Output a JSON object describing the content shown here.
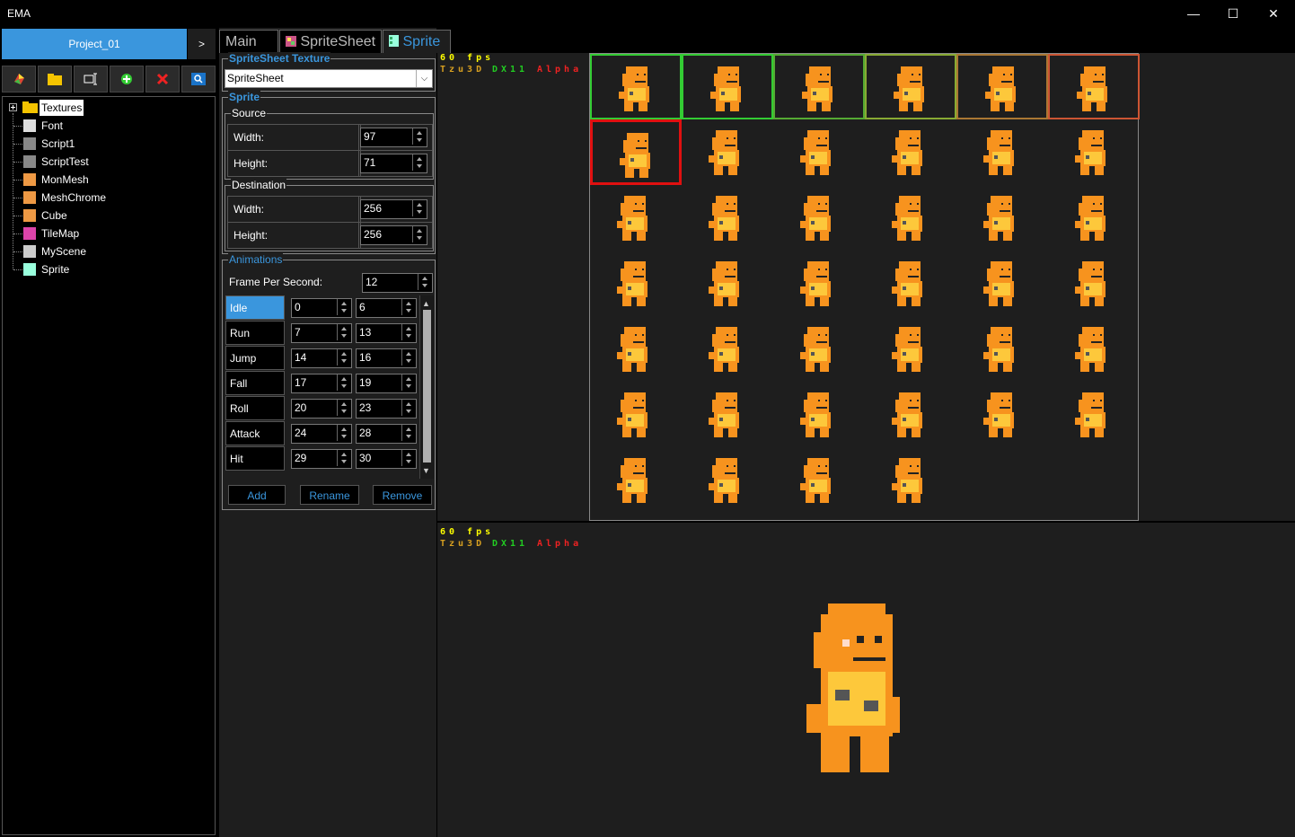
{
  "window": {
    "title": "EMA",
    "minimize": "—",
    "maximize": "☐",
    "close": "✕"
  },
  "project": {
    "name": "Project_01",
    "arrow": ">"
  },
  "toolbar": [
    "new-mesh-icon",
    "folder-icon",
    "rename-icon",
    "add-icon",
    "delete-icon",
    "search-icon"
  ],
  "tree": {
    "root": "Textures",
    "items": [
      {
        "label": "Font",
        "icon": "font-icon"
      },
      {
        "label": "Script1",
        "icon": "script-icon"
      },
      {
        "label": "ScriptTest",
        "icon": "script-icon"
      },
      {
        "label": "MonMesh",
        "icon": "mesh-icon"
      },
      {
        "label": "MeshChrome",
        "icon": "mesh-icon"
      },
      {
        "label": "Cube",
        "icon": "mesh-icon"
      },
      {
        "label": "TileMap",
        "icon": "tilemap-icon"
      },
      {
        "label": "MyScene",
        "icon": "scene-icon"
      },
      {
        "label": "Sprite",
        "icon": "sprite-icon"
      }
    ]
  },
  "tabs": [
    {
      "label": "Main"
    },
    {
      "label": "SpriteSheet"
    },
    {
      "label": "Sprite"
    }
  ],
  "texture": {
    "group": "SpriteSheet Texture",
    "selected": "SpriteSheet"
  },
  "sprite": {
    "group": "Sprite",
    "source": {
      "label": "Source",
      "width_label": "Width:",
      "width": "97",
      "height_label": "Height:",
      "height": "71"
    },
    "destination": {
      "label": "Destination",
      "width_label": "Width:",
      "width": "256",
      "height_label": "Height:",
      "height": "256"
    }
  },
  "animations": {
    "group": "Animations",
    "fps_label": "Frame Per Second:",
    "fps": "12",
    "list": [
      {
        "name": "Idle",
        "start": "0",
        "end": "6"
      },
      {
        "name": "Run",
        "start": "7",
        "end": "13"
      },
      {
        "name": "Jump",
        "start": "14",
        "end": "16"
      },
      {
        "name": "Fall",
        "start": "17",
        "end": "19"
      },
      {
        "name": "Roll",
        "start": "20",
        "end": "23"
      },
      {
        "name": "Attack",
        "start": "24",
        "end": "28"
      },
      {
        "name": "Hit",
        "start": "29",
        "end": "30"
      }
    ],
    "add": "Add",
    "rename": "Rename",
    "remove": "Remove"
  },
  "overlay": {
    "fps": "60 fps",
    "engine": "Tzu3D",
    "api": "DX11",
    "mode": "Alpha"
  },
  "colors": {
    "accent": "#3a96dd",
    "selected_frame": "#e01010",
    "character": "#f7931e"
  }
}
